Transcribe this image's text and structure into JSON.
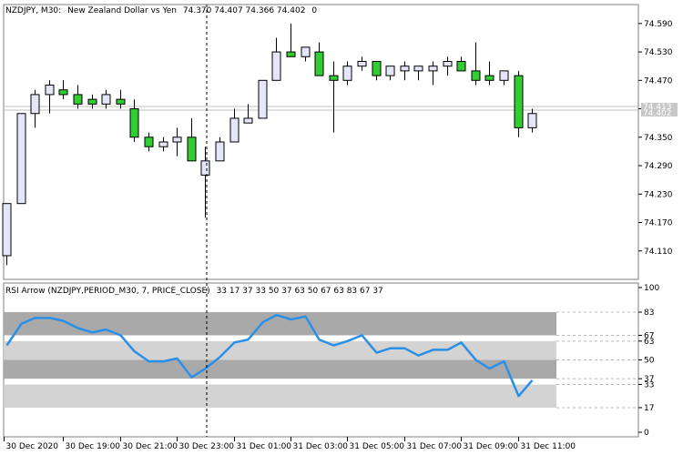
{
  "main_header": {
    "symbol_tf": "NZDJPY, M30:",
    "description": "New Zealand Dollar vs Yen",
    "ohlc": "74.370 74.407 74.366 74.402",
    "volume": "0"
  },
  "indicator_header": {
    "label": "RSI Arrow (NZDJPY,PERIOD_M30, 7, PRICE_CLOSE)",
    "values": "33 17 37 33 50 37 63 50 67 63 83 67 37"
  },
  "price_axis_labels": [
    "74.590",
    "74.530",
    "74.470",
    "74.410",
    "74.350",
    "74.290",
    "74.230",
    "74.170",
    "74.110"
  ],
  "current_price_tags": [
    "74.413",
    "74.402"
  ],
  "rsi_axis_labels": [
    "100",
    "83",
    "67",
    "63",
    "50",
    "37",
    "33",
    "17",
    "0"
  ],
  "time_axis_labels": [
    "30 Dec 2020",
    "30 Dec 19:00",
    "30 Dec 21:00",
    "30 Dec 23:00",
    "31 Dec 01:00",
    "31 Dec 03:00",
    "31 Dec 05:00",
    "31 Dec 07:00",
    "31 Dec 09:00",
    "31 Dec 11:00"
  ],
  "colors": {
    "bull_fill": "#e6e6fa",
    "bear_fill": "#32cd32",
    "candle_outline": "#000000",
    "rsi_line": "#2a8fe8",
    "band_dark": "#a9a9a9",
    "band_light": "#d3d3d3",
    "grid_dash": "#b8b8b8",
    "frame": "#7f7f7f"
  },
  "chart_data": {
    "type": "candlestick",
    "price_range": [
      74.05,
      74.63
    ],
    "candles": [
      {
        "o": 74.1,
        "h": 74.21,
        "l": 74.08,
        "c": 74.21
      },
      {
        "o": 74.21,
        "h": 74.4,
        "l": 74.21,
        "c": 74.4
      },
      {
        "o": 74.4,
        "h": 74.45,
        "l": 74.37,
        "c": 74.44
      },
      {
        "o": 74.44,
        "h": 74.47,
        "l": 74.4,
        "c": 74.46
      },
      {
        "o": 74.45,
        "h": 74.47,
        "l": 74.43,
        "c": 74.44
      },
      {
        "o": 74.44,
        "h": 74.46,
        "l": 74.41,
        "c": 74.42
      },
      {
        "o": 74.43,
        "h": 74.44,
        "l": 74.41,
        "c": 74.42
      },
      {
        "o": 74.42,
        "h": 74.45,
        "l": 74.41,
        "c": 74.44
      },
      {
        "o": 74.43,
        "h": 74.45,
        "l": 74.41,
        "c": 74.42
      },
      {
        "o": 74.41,
        "h": 74.43,
        "l": 74.34,
        "c": 74.35
      },
      {
        "o": 74.35,
        "h": 74.36,
        "l": 74.32,
        "c": 74.33
      },
      {
        "o": 74.33,
        "h": 74.35,
        "l": 74.32,
        "c": 74.34
      },
      {
        "o": 74.34,
        "h": 74.37,
        "l": 74.31,
        "c": 74.35
      },
      {
        "o": 74.35,
        "h": 74.39,
        "l": 74.3,
        "c": 74.3
      },
      {
        "o": 74.27,
        "h": 74.33,
        "l": 74.18,
        "c": 74.3
      },
      {
        "o": 74.3,
        "h": 74.35,
        "l": 74.3,
        "c": 74.34
      },
      {
        "o": 74.34,
        "h": 74.41,
        "l": 74.34,
        "c": 74.39
      },
      {
        "o": 74.38,
        "h": 74.42,
        "l": 74.38,
        "c": 74.39
      },
      {
        "o": 74.39,
        "h": 74.47,
        "l": 74.39,
        "c": 74.47
      },
      {
        "o": 74.47,
        "h": 74.56,
        "l": 74.47,
        "c": 74.53
      },
      {
        "o": 74.53,
        "h": 74.59,
        "l": 74.52,
        "c": 74.52
      },
      {
        "o": 74.52,
        "h": 74.54,
        "l": 74.51,
        "c": 74.54
      },
      {
        "o": 74.53,
        "h": 74.55,
        "l": 74.48,
        "c": 74.48
      },
      {
        "o": 74.48,
        "h": 74.51,
        "l": 74.36,
        "c": 74.47
      },
      {
        "o": 74.47,
        "h": 74.51,
        "l": 74.46,
        "c": 74.5
      },
      {
        "o": 74.5,
        "h": 74.52,
        "l": 74.49,
        "c": 74.51
      },
      {
        "o": 74.51,
        "h": 74.51,
        "l": 74.47,
        "c": 74.48
      },
      {
        "o": 74.48,
        "h": 74.5,
        "l": 74.47,
        "c": 74.5
      },
      {
        "o": 74.49,
        "h": 74.51,
        "l": 74.47,
        "c": 74.5
      },
      {
        "o": 74.49,
        "h": 74.5,
        "l": 74.47,
        "c": 74.5
      },
      {
        "o": 74.49,
        "h": 74.51,
        "l": 74.46,
        "c": 74.5
      },
      {
        "o": 74.5,
        "h": 74.52,
        "l": 74.48,
        "c": 74.51
      },
      {
        "o": 74.51,
        "h": 74.52,
        "l": 74.49,
        "c": 74.49
      },
      {
        "o": 74.49,
        "h": 74.55,
        "l": 74.46,
        "c": 74.47
      },
      {
        "o": 74.48,
        "h": 74.51,
        "l": 74.46,
        "c": 74.47
      },
      {
        "o": 74.47,
        "h": 74.49,
        "l": 74.46,
        "c": 74.49
      },
      {
        "o": 74.48,
        "h": 74.49,
        "l": 74.35,
        "c": 74.37
      },
      {
        "o": 74.37,
        "h": 74.41,
        "l": 74.36,
        "c": 74.4
      }
    ],
    "rsi_range": [
      0,
      100
    ],
    "rsi_values": [
      60,
      75,
      79,
      79,
      77,
      72,
      69,
      71,
      67,
      56,
      49,
      49,
      51,
      38,
      44,
      52,
      62,
      64,
      76,
      81,
      78,
      80,
      64,
      60,
      63,
      67,
      55,
      58,
      58,
      53,
      57,
      57,
      62,
      50,
      44,
      49,
      25,
      36
    ],
    "rsi_bands": [
      {
        "from": 67,
        "to": 83,
        "shade": "dark"
      },
      {
        "from": 50,
        "to": 63,
        "shade": "light"
      },
      {
        "from": 37,
        "to": 50,
        "shade": "dark"
      },
      {
        "from": 17,
        "to": 33,
        "shade": "light"
      }
    ],
    "rsi_dashed_levels": [
      83,
      67,
      63,
      50,
      37,
      33,
      17
    ]
  }
}
